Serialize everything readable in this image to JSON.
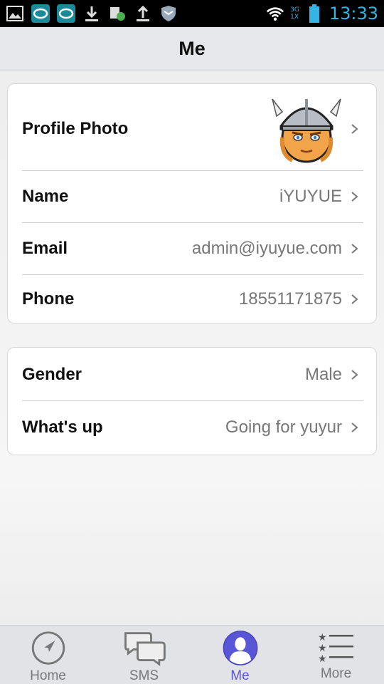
{
  "status_bar": {
    "time": "13:33",
    "network_top": "3G",
    "network_bottom": "1X"
  },
  "header": {
    "title": "Me"
  },
  "profile": {
    "photo_label": "Profile Photo",
    "name_label": "Name",
    "name_value": "iYUYUE",
    "email_label": "Email",
    "email_value": "admin@iyuyue.com",
    "phone_label": "Phone",
    "phone_value": "18551171875"
  },
  "details": {
    "gender_label": "Gender",
    "gender_value": "Male",
    "whatsup_label": "What's up",
    "whatsup_value": "Going for yuyur"
  },
  "tabs": [
    {
      "label": "Home",
      "icon": "compass-icon"
    },
    {
      "label": "SMS",
      "icon": "chat-bubbles-icon"
    },
    {
      "label": "Me",
      "icon": "person-icon",
      "active": true
    },
    {
      "label": "More",
      "icon": "list-icon"
    }
  ],
  "colors": {
    "accent": "#5856d6",
    "status_blue": "#33b5e5"
  }
}
